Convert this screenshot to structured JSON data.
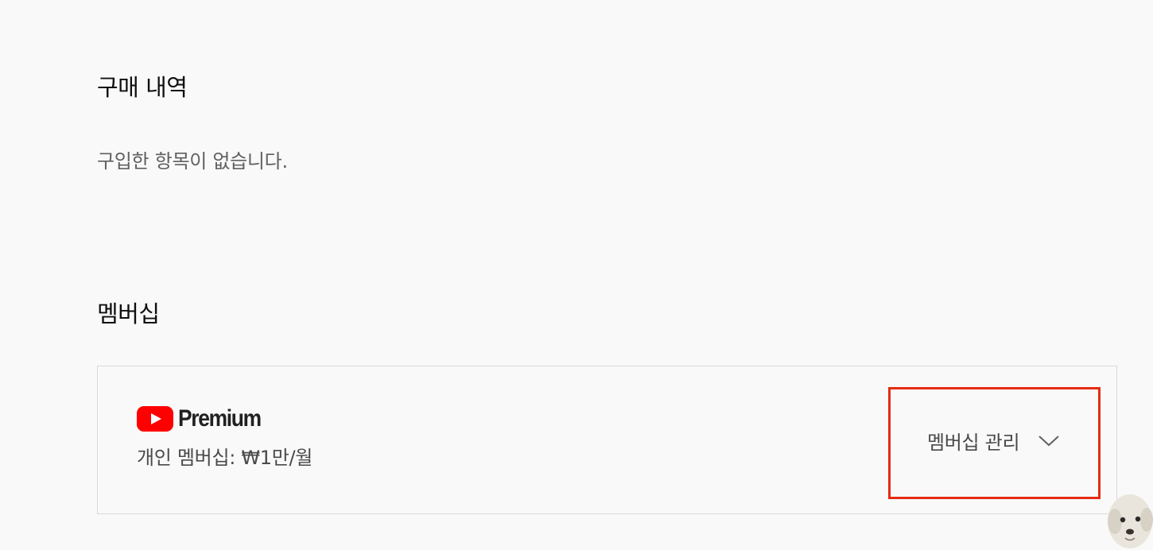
{
  "purchases": {
    "title": "구매 내역",
    "empty_message": "구입한 항목이 없습니다."
  },
  "membership": {
    "title": "멤버십",
    "card": {
      "logo_text": "Premium",
      "plan": "개인 멤버십: ₩1만/월",
      "manage_label": "멤버십 관리"
    }
  },
  "colors": {
    "brand_red": "#ff0000",
    "highlight_box": "#e52b12",
    "background": "#f9f9f9"
  },
  "icons": {
    "logo": "youtube-play-icon",
    "expand": "chevron-down-icon"
  }
}
